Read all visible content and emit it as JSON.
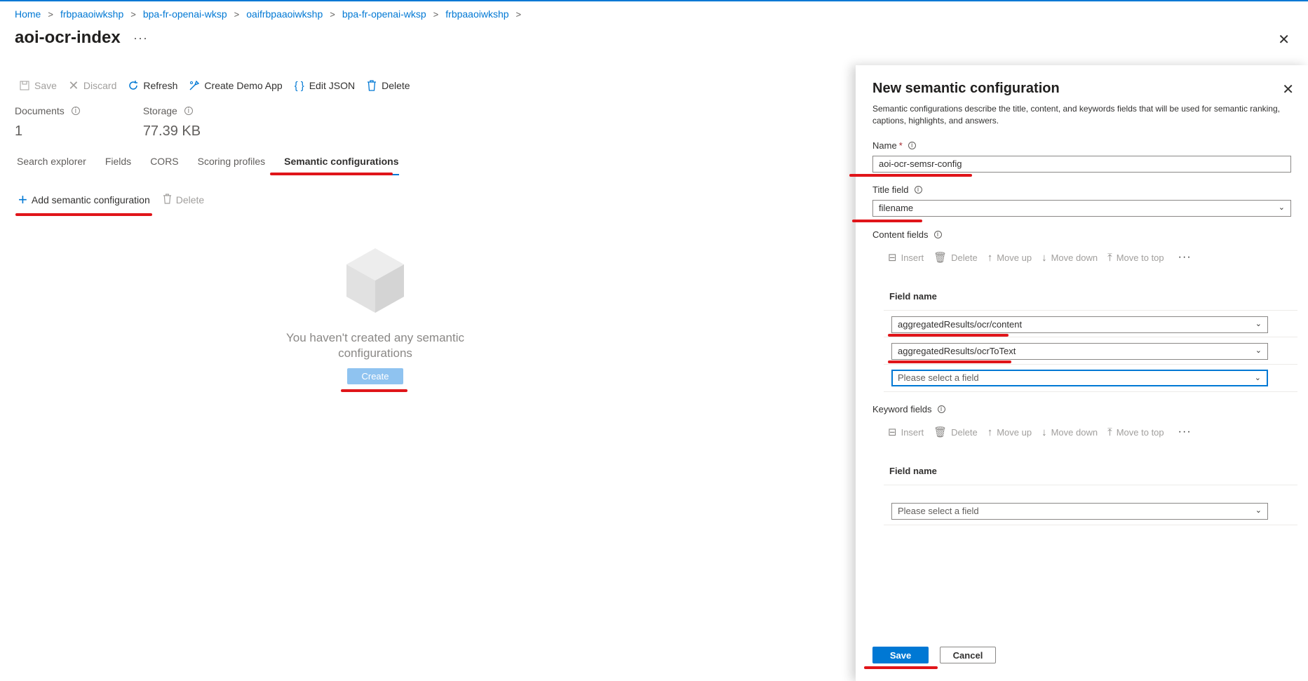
{
  "breadcrumb": [
    "Home",
    "frbpaaoiwkshp",
    "bpa-fr-openai-wksp",
    "oaifrbpaaoiwkshp",
    "bpa-fr-openai-wksp",
    "frbpaaoiwkshp"
  ],
  "page": {
    "title": "aoi-ocr-index",
    "more": "···",
    "close": "✕"
  },
  "toolbar": {
    "save": "Save",
    "discard": "Discard",
    "refresh": "Refresh",
    "create_demo_app": "Create Demo App",
    "edit_json": "Edit JSON",
    "delete": "Delete"
  },
  "stats": {
    "documents_label": "Documents",
    "documents_value": "1",
    "storage_label": "Storage",
    "storage_value": "77.39 KB"
  },
  "tabs": [
    "Search explorer",
    "Fields",
    "CORS",
    "Scoring profiles",
    "Semantic configurations"
  ],
  "commands": {
    "add": "Add semantic configuration",
    "delete": "Delete"
  },
  "empty_state": {
    "message": "You haven't created any semantic configurations",
    "create_label": "Create"
  },
  "panel": {
    "title": "New semantic configuration",
    "description": "Semantic configurations describe the title, content, and keywords fields that will be used for semantic ranking, captions, highlights, and answers.",
    "name_label": "Name",
    "name_required": "*",
    "name_value": "aoi-ocr-semsr-config",
    "title_field_label": "Title field",
    "title_field_value": "filename",
    "content_fields_label": "Content fields",
    "keyword_fields_label": "Keyword fields",
    "cmd": {
      "insert": "Insert",
      "delete": "Delete",
      "move_up": "Move up",
      "move_down": "Move down",
      "move_to_top": "Move to top",
      "more": "···"
    },
    "field_name_header": "Field name",
    "content_fields": [
      "aggregatedResults/ocr/content",
      "aggregatedResults/ocrToText",
      "Please select a field"
    ],
    "keyword_fields": [
      "Please select a field"
    ],
    "save_label": "Save",
    "cancel_label": "Cancel"
  },
  "colors": {
    "accent": "#0078d4",
    "annotation": "#e0151a",
    "required": "#a4262c"
  }
}
